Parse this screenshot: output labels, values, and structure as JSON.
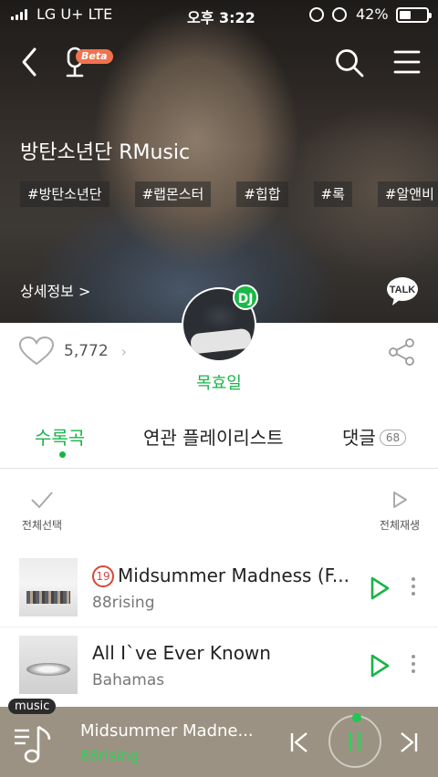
{
  "status_bar": {
    "carrier": "LG U+  LTE",
    "time": "오후 3:22",
    "battery_percent": "42%",
    "battery_level": 0.42
  },
  "header": {
    "beta_badge": "Beta",
    "icons": [
      "back-icon",
      "microphone-icon",
      "search-icon",
      "menu-icon"
    ]
  },
  "playlist": {
    "title": "방탄소년단 RMusic",
    "tags": [
      "#방탄소년단",
      "#랩몬스터",
      "#힙합",
      "#록",
      "#알앤비"
    ],
    "detail_link": "상세정보 >",
    "talk_label": "TALK",
    "like_count": "5,772",
    "dj_badge": "DJ",
    "dj_name": "목효일"
  },
  "tabs": [
    {
      "label": "수록곡",
      "active": true
    },
    {
      "label": "연관 플레이리스트",
      "active": false
    },
    {
      "label": "댓글",
      "count": "68",
      "active": false
    }
  ],
  "list_actions": {
    "select_all": "전체선택",
    "play_all": "전체재생"
  },
  "tracks": [
    {
      "age_rating": "19",
      "title": "Midsummer Madness (F...",
      "artist": "88rising"
    },
    {
      "title": "All I`ve Ever Known",
      "artist": "Bahamas"
    }
  ],
  "player": {
    "tag": "music",
    "title": "Midsummer Madne...",
    "artist": "88rising"
  },
  "colors": {
    "accent_green": "#19b449",
    "age_red": "#d9463a",
    "beta_orange": "#f0734e",
    "player_bg": "#9c9283"
  }
}
